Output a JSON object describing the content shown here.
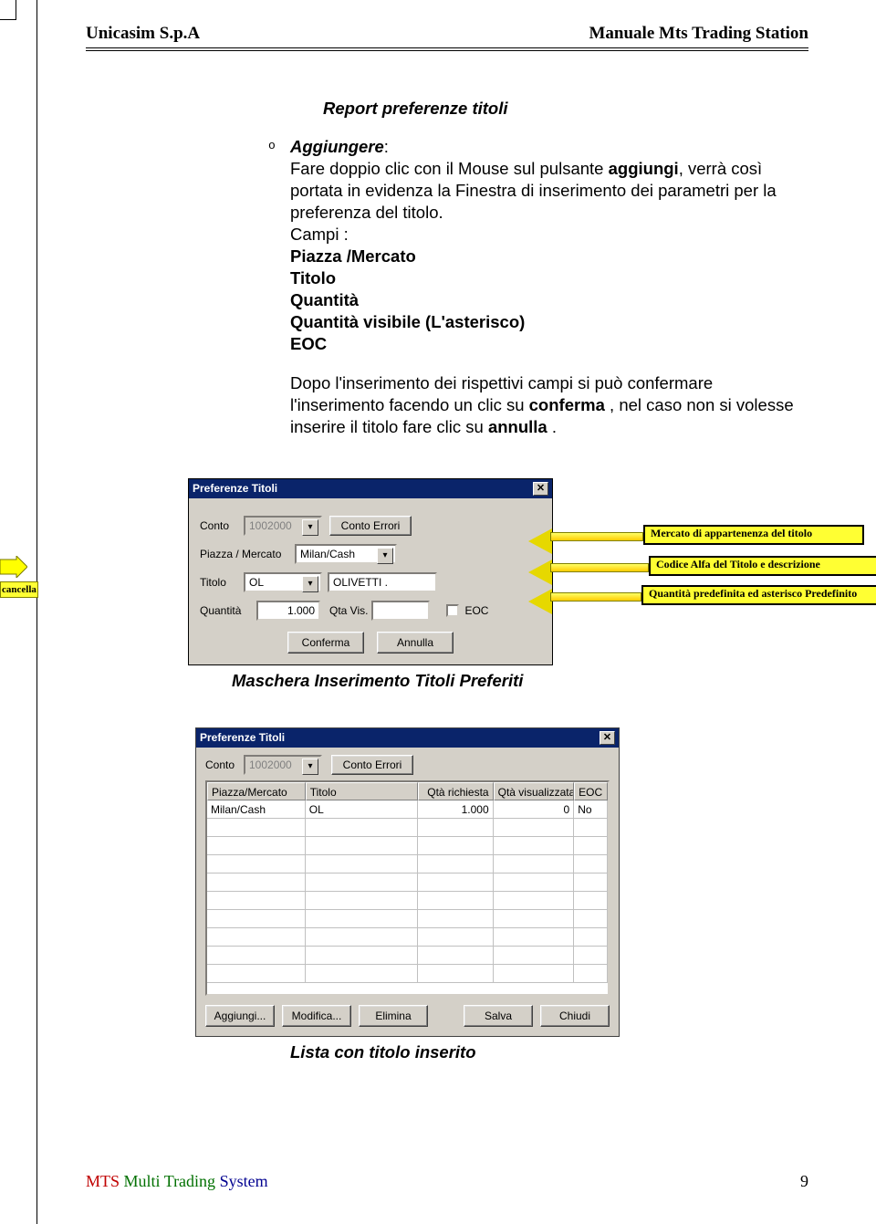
{
  "header": {
    "left": "Unicasim S.p.A",
    "right": "Manuale Mts Trading Station"
  },
  "section_title": "Report preferenze  titoli",
  "bullet_o": "o",
  "aggiungere": {
    "label": "Aggiungere",
    "colon": ":",
    "p1a": "Fare doppio clic con il Mouse sul pulsante ",
    "p1b": "aggiungi",
    "p1c": ", verrà così portata in evidenza la Finestra di inserimento dei parametri per la preferenza del titolo.",
    "campi_lbl": "Campi :",
    "c1": "Piazza /Mercato",
    "c2": "Titolo",
    "c3": "Quantità",
    "c4": "Quantità visibile (L'asterisco)",
    "c5": "EOC",
    "p2a": "Dopo l'inserimento dei rispettivi campi si può confermare l'inserimento facendo un clic su ",
    "p2b": "conferma",
    "p2c": " , nel caso non si volesse inserire il titolo fare clic su ",
    "p2d": "annulla",
    "p2e": " ."
  },
  "dlg1": {
    "title": "Preferenze Titoli",
    "conto_lbl": "Conto",
    "conto_val": "1002000",
    "conto_err_btn": "Conto Errori",
    "piazza_lbl": "Piazza / Mercato",
    "piazza_val": "Milan/Cash",
    "titolo_lbl": "Titolo",
    "titolo_val": "OL",
    "titolo_desc": "OLIVETTI       .",
    "qta_lbl": "Quantità",
    "qta_val": "1.000",
    "qtavis_lbl": "Qta Vis.",
    "qtavis_val": "",
    "eoc_lbl": "EOC",
    "conferma": "Conferma",
    "annulla": "Annulla"
  },
  "callouts": {
    "c1": "Mercato di appartenenza del titolo",
    "c2": "Codice Alfa del Titolo e descrizione",
    "c3": "Quantità predefinita ed asterisco Predefinito",
    "side": "cancella"
  },
  "caption1": "Maschera Inserimento Titoli Preferiti",
  "dlg2": {
    "title": "Preferenze Titoli",
    "conto_lbl": "Conto",
    "conto_val": "1002000",
    "conto_err_btn": "Conto Errori",
    "cols": {
      "c1": "Piazza/Mercato",
      "c2": "Titolo",
      "c3": "Qtà richiesta",
      "c4": "Qtà visualizzata",
      "c5": "EOC"
    },
    "row": {
      "c1": "Milan/Cash",
      "c2": "OL",
      "c3": "1.000",
      "c4": "0",
      "c5": "No"
    },
    "btns": {
      "b1": "Aggiungi...",
      "b2": "Modifica...",
      "b3": "Elimina",
      "b4": "Salva",
      "b5": "Chiudi"
    }
  },
  "caption2": "Lista con titolo inserito",
  "footer": {
    "a": "MTS",
    "sep": "   ",
    "b": "Multi ",
    "c": "Trading ",
    "d": "System",
    "page": "9"
  }
}
